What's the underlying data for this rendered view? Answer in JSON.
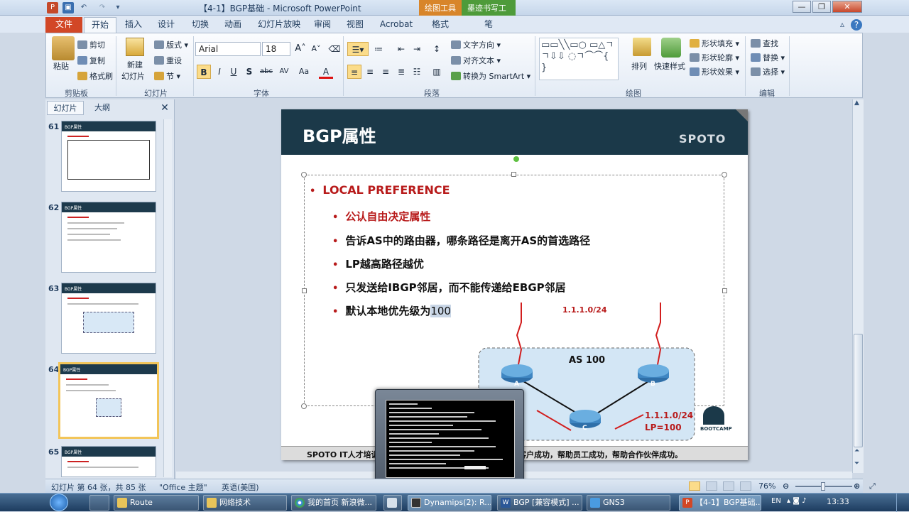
{
  "window": {
    "title": "【4-1】BGP基础 - Microsoft PowerPoint",
    "context_tabs": [
      "绘图工具",
      "墨迹书写工具"
    ],
    "context_subtabs": [
      "格式",
      "笔"
    ]
  },
  "ribbon_tabs": [
    "文件",
    "开始",
    "插入",
    "设计",
    "切换",
    "动画",
    "幻灯片放映",
    "审阅",
    "视图",
    "Acrobat"
  ],
  "ribbon": {
    "clipboard": {
      "paste": "粘贴",
      "cut": "剪切",
      "copy": "复制",
      "format_painter": "格式刷",
      "label": "剪贴板"
    },
    "slides": {
      "new_slide": "新建\n幻灯片",
      "new_slide_line1": "新建",
      "new_slide_line2": "幻灯片",
      "layout": "版式",
      "reset": "重设",
      "section": "节",
      "label": "幻灯片"
    },
    "font": {
      "name": "Arial",
      "size": "18",
      "label": "字体",
      "bold": "B",
      "italic": "I",
      "underline": "U",
      "shadow": "S",
      "strike": "abc",
      "spacing": "AV",
      "case": "Aa",
      "color": "A"
    },
    "paragraph": {
      "text_direction": "文字方向",
      "align_text": "对齐文本",
      "smartart": "转换为 SmartArt",
      "label": "段落"
    },
    "drawing": {
      "arrange": "排列",
      "quick_styles": "快速样式",
      "shape_fill": "形状填充",
      "shape_outline": "形状轮廓",
      "shape_effects": "形状效果",
      "label": "绘图"
    },
    "editing": {
      "find": "查找",
      "replace": "替换",
      "select": "选择",
      "label": "编辑"
    }
  },
  "left_panel": {
    "tabs": [
      "幻灯片",
      "大纲"
    ],
    "thumbnails": [
      {
        "num": "61",
        "title": "BGP属性"
      },
      {
        "num": "62",
        "title": "BGP属性"
      },
      {
        "num": "63",
        "title": "BGP属性"
      },
      {
        "num": "64",
        "title": "BGP属性"
      },
      {
        "num": "65",
        "title": "BGP属性"
      }
    ],
    "selected": "64"
  },
  "slide": {
    "title": "BGP属性",
    "brand": "SPOTO",
    "bullets": [
      {
        "text": "LOCAL PREFERENCE",
        "level": 1,
        "red": true
      },
      {
        "text": "公认自由决定属性",
        "level": 2,
        "red": true
      },
      {
        "text": "告诉AS中的路由器，哪条路径是离开AS的首选路径",
        "level": 2,
        "red": false
      },
      {
        "text": "LP越高路径越优",
        "level": 2,
        "red": false
      },
      {
        "text": "只发送给IBGP邻居，而不能传递给EBGP邻居",
        "level": 2,
        "red": false
      },
      {
        "text_prefix": "默认本地优先级为",
        "text_highlight": "100",
        "level": 2,
        "red": false
      }
    ],
    "diagram": {
      "prefix_top": "1.1.1.0/24",
      "as_label": "AS 100",
      "routers": [
        "A",
        "B",
        "C"
      ],
      "prefix_bottom": "1.1.1.0/24",
      "lp": "LP=100"
    },
    "footer": "SPOTO IT人才培训",
    "footer_tail": "客户成功，帮助员工成功，帮助合作伙伴成功。",
    "logo_text": "BOOTCAMP"
  },
  "status": {
    "slide_info": "幻灯片 第 64 张，共 85 张",
    "theme": "\"Office 主题\"",
    "language": "英语(美国)",
    "zoom": "76%"
  },
  "taskbar": {
    "items": [
      "Route",
      "网络技术",
      "我的首页 新浪微...",
      "Dynamips(2): R...",
      "BGP [兼容模式] ...",
      "GNS3",
      "【4-1】BGP基础..."
    ],
    "lang": "EN",
    "time": "13:33"
  },
  "colors": {
    "accent_red": "#b81b1b",
    "header_dark": "#1b3949",
    "file_tab": "#d24726"
  }
}
